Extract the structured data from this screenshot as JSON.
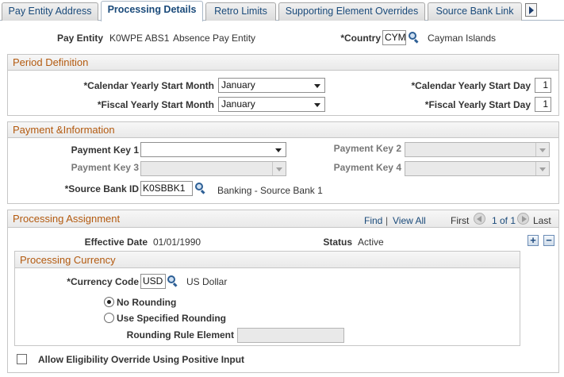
{
  "tabs": [
    {
      "label": "Pay Entity Address",
      "active": false
    },
    {
      "label": "Processing Details",
      "active": true
    },
    {
      "label": "Retro Limits",
      "active": false
    },
    {
      "label": "Supporting Element Overrides",
      "active": false
    },
    {
      "label": "Source Bank Link",
      "active": false
    }
  ],
  "header": {
    "pay_entity_label": "Pay Entity",
    "pay_entity_code": "K0WPE ABS1",
    "pay_entity_desc": "Absence Pay Entity",
    "country_label": "*Country",
    "country_value": "CYM",
    "country_desc": "Cayman Islands"
  },
  "period": {
    "title": "Period Definition",
    "cal_month_label": "*Calendar Yearly Start Month",
    "cal_month_value": "January",
    "cal_day_label": "*Calendar Yearly Start Day",
    "cal_day_value": "1",
    "fis_month_label": "*Fiscal Yearly Start Month",
    "fis_month_value": "January",
    "fis_day_label": "*Fiscal Yearly Start Day",
    "fis_day_value": "1"
  },
  "payment": {
    "title": "Payment &Information",
    "key1_label": "Payment Key 1",
    "key1_value": "",
    "key2_label": "Payment Key 2",
    "key3_label": "Payment Key 3",
    "key4_label": "Payment Key 4",
    "bank_label": "*Source Bank ID",
    "bank_value": "K0SBBK1",
    "bank_desc": "Banking - Source Bank 1"
  },
  "assignment": {
    "title": "Processing Assignment",
    "find": "Find",
    "sep": "|",
    "view_all": "View All",
    "first": "First",
    "range": "1 of 1",
    "last": "Last",
    "eff_date_label": "Effective Date",
    "eff_date_value": "01/01/1990",
    "status_label": "Status",
    "status_value": "Active",
    "add_symbol": "+",
    "remove_symbol": "−"
  },
  "currency": {
    "title": "Processing Currency",
    "code_label": "*Currency Code",
    "code_value": "USD",
    "code_desc": "US Dollar",
    "opt_no_rounding": "No Rounding",
    "opt_specified": "Use Specified Rounding",
    "selected": "No Rounding",
    "rule_label": "Rounding Rule Element",
    "rule_value": ""
  },
  "eligibility": {
    "label": "Allow Eligibility Override Using Positive Input",
    "checked": false
  }
}
